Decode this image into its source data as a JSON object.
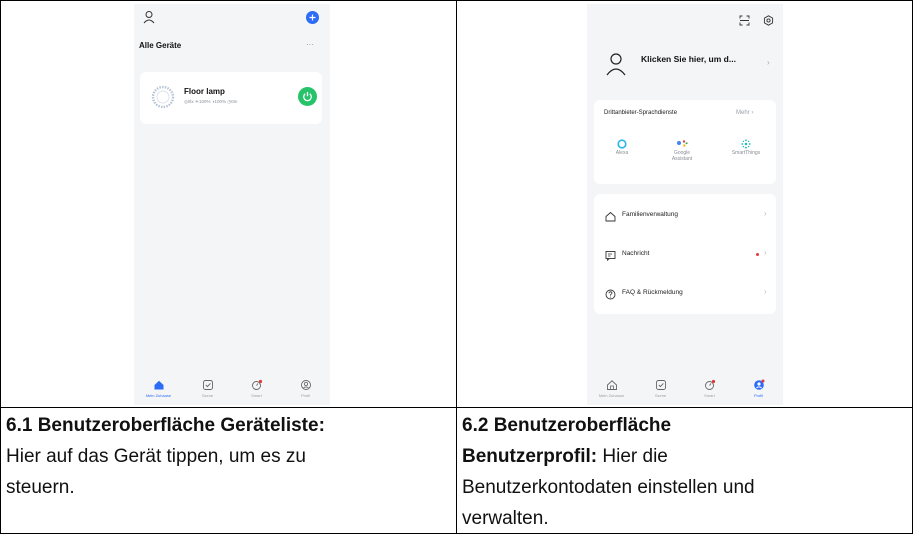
{
  "left_screen": {
    "header_title": "Alle Geräte",
    "more_label": "···",
    "device": {
      "name": "Floor lamp",
      "status_line": "◎0lx  ☀100%  ◑100%  ◷0m"
    },
    "tabs": [
      {
        "label": "Mein Zuhause",
        "active": true
      },
      {
        "label": "Szene",
        "active": false
      },
      {
        "label": "Smart",
        "active": false
      },
      {
        "label": "Profil",
        "active": false
      }
    ]
  },
  "right_screen": {
    "login_prompt": "Klicken Sie hier, um d...",
    "services": {
      "title": "Drittanbieter-Sprachdienste",
      "more_label": "Mehr",
      "items": [
        {
          "label": "Alexa"
        },
        {
          "label": "Google Assistant"
        },
        {
          "label": "SmartThings"
        }
      ]
    },
    "menu": [
      {
        "label": "Familienverwaltung"
      },
      {
        "label": "Nachricht"
      },
      {
        "label": "FAQ & Rückmeldung"
      }
    ],
    "tabs": [
      {
        "label": "Mein Zuhause",
        "active": false
      },
      {
        "label": "Szene",
        "active": false
      },
      {
        "label": "Smart",
        "active": false
      },
      {
        "label": "Profil",
        "active": true
      }
    ]
  },
  "captions": {
    "left": {
      "heading": "6.1  Benutzeroberfläche Geräteliste:",
      "text_line1": "Hier auf das Gerät tippen, um es zu",
      "text_line2": "steuern."
    },
    "right": {
      "heading_line1": "6.2  Benutzeroberfläche",
      "heading_line2_bold": "Benutzerprofil:",
      "heading_line2_rest": " Hier die",
      "text_line3": "Benutzerkontodaten einstellen und",
      "text_line4": "verwalten."
    }
  },
  "colors": {
    "accent_blue": "#2d6cf6",
    "power_green": "#27c36a",
    "notification_red": "#e23b3b",
    "border": "#000000"
  }
}
